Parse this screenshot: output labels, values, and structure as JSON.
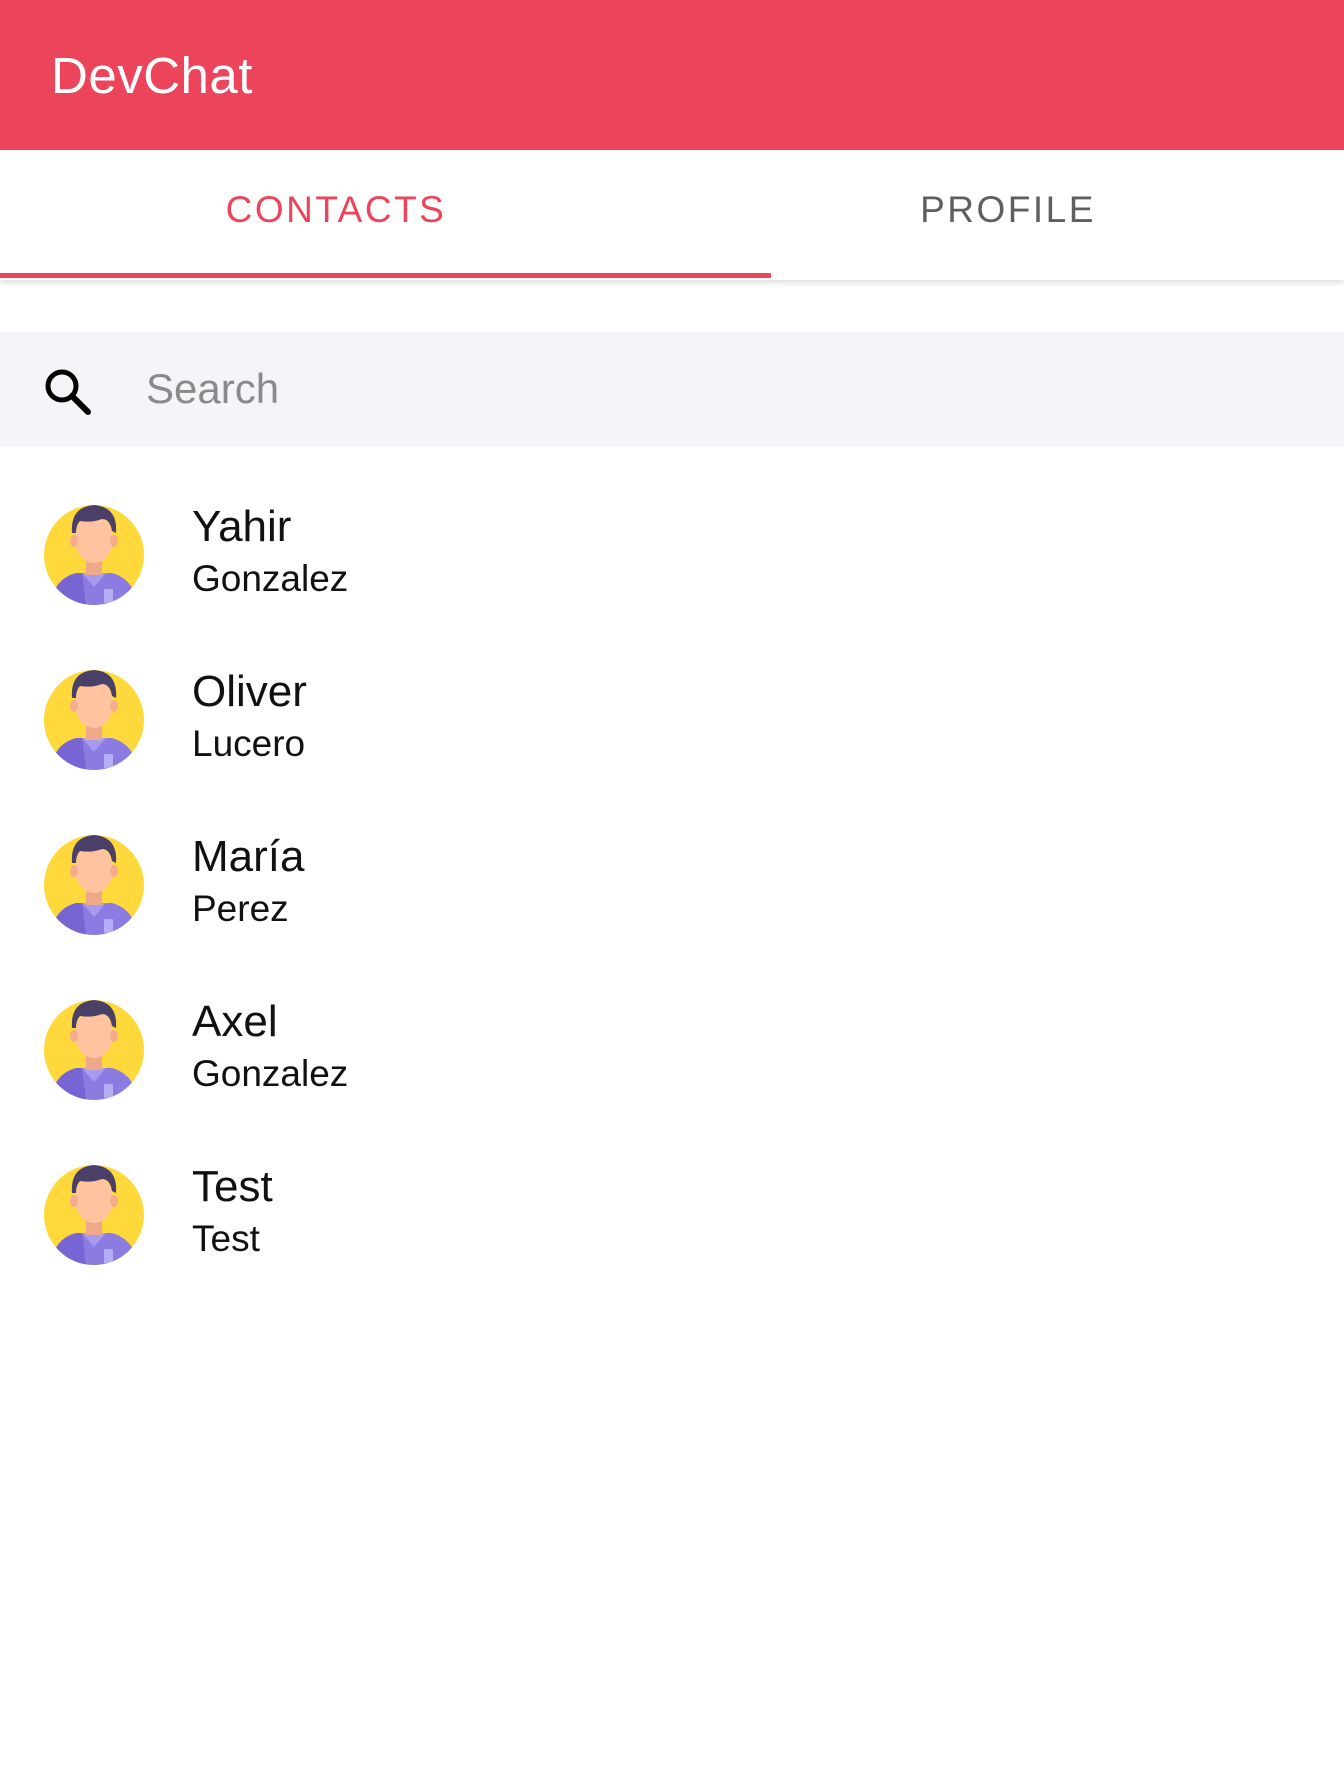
{
  "app": {
    "title": "DevChat",
    "accent_color": "#EC445A"
  },
  "tabs": [
    {
      "label": "CONTACTS",
      "active": true
    },
    {
      "label": "PROFILE",
      "active": false
    }
  ],
  "search": {
    "icon": "search-icon",
    "placeholder": "Search",
    "value": ""
  },
  "contacts": [
    {
      "first_name": "Yahir",
      "last_name": "Gonzalez",
      "avatar": "user-avatar"
    },
    {
      "first_name": "Oliver",
      "last_name": "Lucero",
      "avatar": "user-avatar"
    },
    {
      "first_name": "María",
      "last_name": "Perez",
      "avatar": "user-avatar"
    },
    {
      "first_name": "Axel",
      "last_name": "Gonzalez",
      "avatar": "user-avatar"
    },
    {
      "first_name": "Test",
      "last_name": "Test",
      "avatar": "user-avatar"
    }
  ]
}
